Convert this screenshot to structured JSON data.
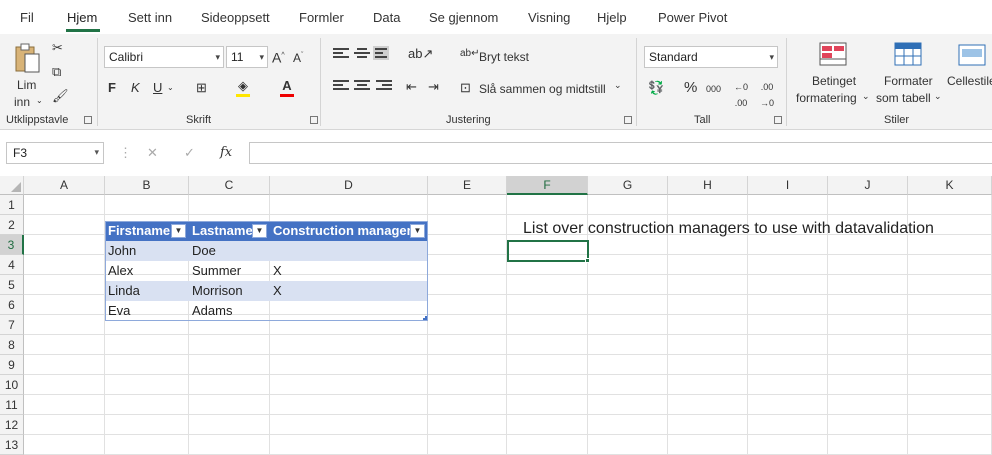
{
  "ribbon_tabs": [
    "Fil",
    "Hjem",
    "Sett inn",
    "Sideoppsett",
    "Formler",
    "Data",
    "Se gjennom",
    "Visning",
    "Hjelp",
    "Power Pivot"
  ],
  "active_tab": "Hjem",
  "clipboard": {
    "paste_line1": "Lim",
    "paste_line2": "inn",
    "group_label": "Utklippstavle"
  },
  "font": {
    "family": "Calibri",
    "size": "11",
    "bold": "F",
    "italic": "K",
    "underline": "U",
    "group_label": "Skrift"
  },
  "alignment": {
    "wrap_text": "Bryt tekst",
    "merge_center": "Slå sammen og midtstill",
    "group_label": "Justering"
  },
  "number": {
    "format": "Standard",
    "group_label": "Tall"
  },
  "styles": {
    "conditional_line1": "Betinget",
    "conditional_line2": "formatering",
    "format_table_line1": "Formater",
    "format_table_line2": "som tabell",
    "cell_styles_line1": "Cellestile",
    "group_label": "Stiler"
  },
  "formula_bar": {
    "name_box": "F3",
    "fx": "fx",
    "value": ""
  },
  "columns": [
    "A",
    "B",
    "C",
    "D",
    "E",
    "F",
    "G",
    "H",
    "I",
    "J",
    "K"
  ],
  "selected_column": "F",
  "rows": [
    "1",
    "2",
    "3",
    "4",
    "5",
    "6",
    "7",
    "8",
    "9",
    "10",
    "11",
    "12",
    "13"
  ],
  "selected_row": "3",
  "table": {
    "headers": [
      "Firstname",
      "Lastname",
      "Construction manager"
    ],
    "rows": [
      [
        "John",
        "Doe",
        ""
      ],
      [
        "Alex",
        "Summer",
        "X"
      ],
      [
        "Linda",
        "Morrison",
        "X"
      ],
      [
        "Eva",
        "Adams",
        ""
      ]
    ]
  },
  "note_cell": "List over construction managers to use with datavalidation",
  "colors": {
    "accent": "#217346",
    "table_header": "#4472c4",
    "table_band": "#d9e1f2"
  }
}
